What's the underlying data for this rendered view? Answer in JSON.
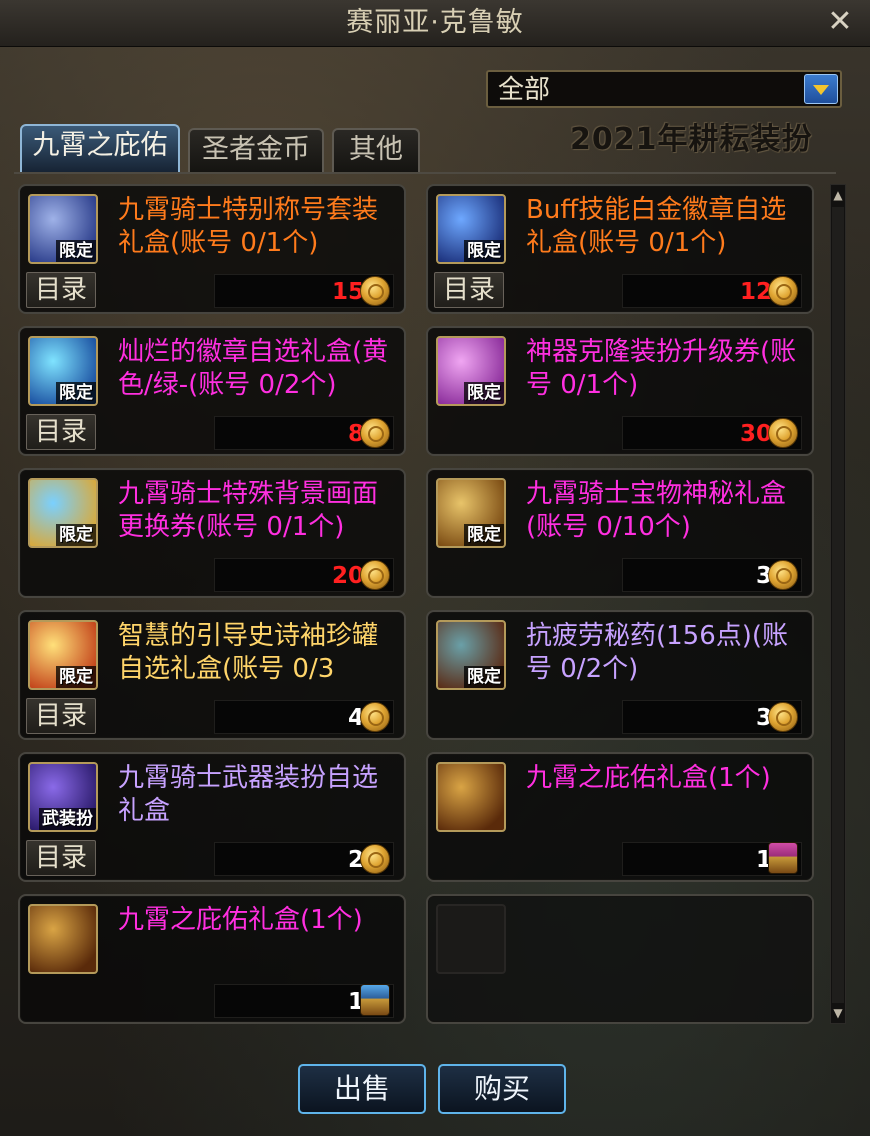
{
  "window": {
    "title": "赛丽亚·克鲁敏",
    "close_label": "✕"
  },
  "filter": {
    "selected": "全部"
  },
  "banner": "2021年耕耘装扮",
  "tabs": [
    {
      "label": "九霄之庇佑",
      "active": true
    },
    {
      "label": "圣者金币",
      "active": false
    },
    {
      "label": "其他",
      "active": false
    }
  ],
  "catalog_label": "目录",
  "items": [
    {
      "name": "九霄骑士特别称号套装礼盒(账号 0/1个)",
      "name_color": "#ff7b1c",
      "badge": "限定",
      "price": "15",
      "currency": "coin",
      "catalog": true,
      "icon_colors": [
        "#9fb2e8",
        "#2a3c8a"
      ]
    },
    {
      "name": "Buff技能白金徽章自选礼盒(账号 0/1个)",
      "name_color": "#ff7b1c",
      "badge": "限定",
      "price": "12",
      "currency": "coin",
      "catalog": true,
      "icon_colors": [
        "#6ea8ff",
        "#1b2f7a"
      ]
    },
    {
      "name": "灿烂的徽章自选礼盒(黄色/绿-(账号 0/2个)",
      "name_color": "#ff2fe0",
      "badge": "限定",
      "price": "8",
      "currency": "coin",
      "catalog": true,
      "icon_colors": [
        "#7fe3ff",
        "#1a4fa0"
      ]
    },
    {
      "name": "神器克隆装扮升级券(账号 0/1个)",
      "name_color": "#ff2fe0",
      "badge": "限定",
      "price": "30",
      "currency": "coin",
      "catalog": false,
      "icon_colors": [
        "#f0a6f2",
        "#8a2c9a"
      ]
    },
    {
      "name": "九霄骑士特殊背景画面更换券(账号 0/1个)",
      "name_color": "#ff2fe0",
      "badge": "限定",
      "price": "20",
      "currency": "coin",
      "catalog": false,
      "icon_colors": [
        "#7ad0ff",
        "#d9a93a"
      ]
    },
    {
      "name": "九霄骑士宝物神秘礼盒(账号 0/10个)",
      "name_color": "#ff2fe0",
      "badge": "限定",
      "price": "3",
      "currency": "coin",
      "catalog": false,
      "icon_colors": [
        "#e8c46a",
        "#7a4a12"
      ]
    },
    {
      "name": "智慧的引导史诗袖珍罐自选礼盒(账号 0/3",
      "name_color": "#ffd56a",
      "badge": "限定",
      "price": "4",
      "currency": "coin",
      "catalog": true,
      "icon_colors": [
        "#ffe07a",
        "#c2421a"
      ]
    },
    {
      "name": "抗疲劳秘药(156点)(账号 0/2个)",
      "name_color": "#c7a2ff",
      "badge": "限定",
      "price": "3",
      "currency": "coin",
      "catalog": false,
      "icon_colors": [
        "#6aa0a8",
        "#5a2a14"
      ]
    },
    {
      "name": "九霄骑士武器装扮自选礼盒",
      "name_color": "#c7a2ff",
      "badge": "武装扮",
      "price": "2",
      "currency": "coin",
      "catalog": true,
      "icon_colors": [
        "#8a6ae8",
        "#2a1a6a"
      ]
    },
    {
      "name": "九霄之庇佑礼盒(1个)",
      "name_color": "#ff2fe0",
      "badge": "",
      "price": "1",
      "currency": "chest",
      "catalog": false,
      "icon_colors": [
        "#d9a445",
        "#5a2a0a"
      ]
    },
    {
      "name": "九霄之庇佑礼盒(1个)",
      "name_color": "#ff2fe0",
      "badge": "",
      "price": "1",
      "currency": "chest-blue",
      "catalog": false,
      "icon_colors": [
        "#d9a445",
        "#5a2a0a"
      ]
    },
    {
      "name": "",
      "name_color": "#ffffff",
      "badge": "",
      "price": "",
      "currency": "none",
      "catalog": false,
      "empty": true
    }
  ],
  "buttons": {
    "sell": "出售",
    "buy": "购买"
  },
  "colors": {
    "price": "#ff2020",
    "price_alt": "#ffffff",
    "accent": "#5fb4ea",
    "tab_active": "#3b5a78"
  }
}
